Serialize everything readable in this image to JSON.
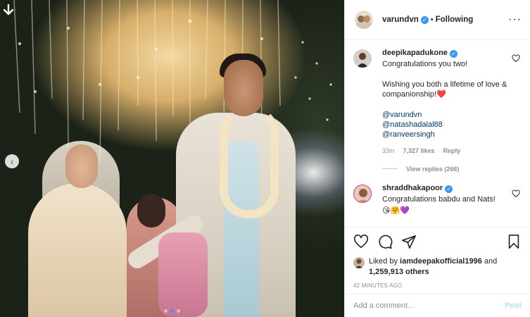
{
  "post": {
    "author": "varundvn",
    "follow_state": "Following",
    "separator": "•"
  },
  "comments": [
    {
      "user": "deepikapadukone",
      "verified": true,
      "text": "Congratulations you two!\n\nWishing you both a lifetime of love & companionship!",
      "emoji_end": "❤️",
      "mentions": [
        "@varundvn",
        "@natashadalal88",
        "@ranveersingh"
      ],
      "time": "33m",
      "likes": "7,327 likes",
      "reply_label": "Reply",
      "view_replies": "View replies (266)"
    },
    {
      "user": "shraddhakapoor",
      "verified": true,
      "text": "Congratulations babdu and Nats!",
      "emojis": "😘🤗💜"
    }
  ],
  "likes": {
    "prefix": "Liked by",
    "liker": "iamdeepakofficial1996",
    "conjunction": "and",
    "others": "1,259,913 others"
  },
  "timestamp": "42 MINUTES AGO",
  "add_comment": {
    "placeholder": "Add a comment…",
    "post_label": "Post"
  },
  "colors": {
    "verified_blue": "#3897f0",
    "mention_blue": "#00376b",
    "muted_gray": "#8e8e8e",
    "heart_red": "#ed4956",
    "post_disabled": "#b2dffc"
  },
  "icons": [
    "download-icon",
    "chevron-left-icon",
    "more-icon",
    "heart-icon",
    "comment-icon",
    "share-icon",
    "bookmark-icon",
    "verified-icon"
  ]
}
